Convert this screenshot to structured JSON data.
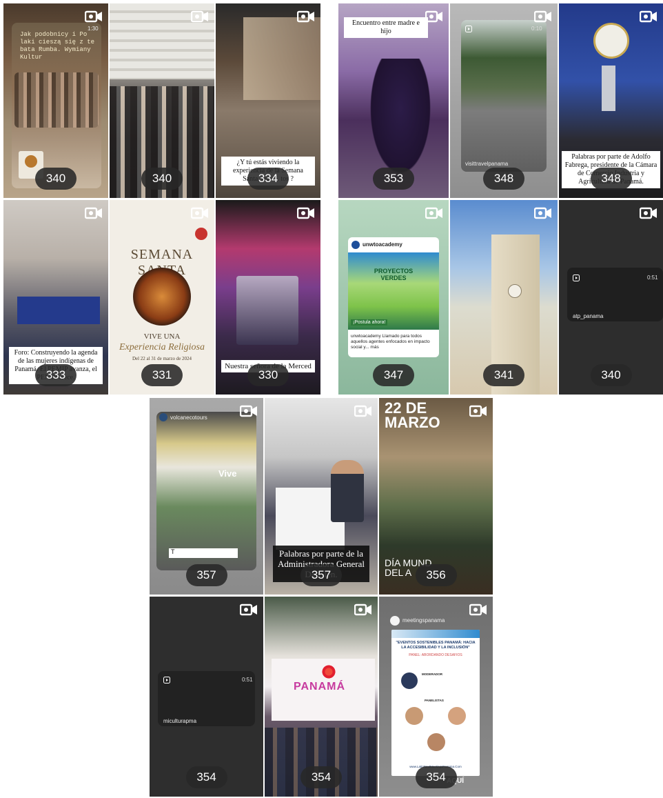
{
  "tiles": [
    {
      "count": "340",
      "overlay": "Jak podobnicy i Po laki cieszą się z te bata Rumba. Wymiany Kultur",
      "time": "1:30"
    },
    {
      "count": "340"
    },
    {
      "count": "334",
      "caption": "¿Y tú estás viviendo la experiencia de la Semana Santa, este ... tos ?"
    },
    {
      "count": "353",
      "caption": "Encuentro entre madre e hijo"
    },
    {
      "count": "348",
      "handle": "visittravelpanama",
      "time": "0:10"
    },
    {
      "count": "348",
      "caption": "Palabras por parte de Adolfo Fabrega, presidente de la Cámara de Comercio Industria y Agricultura de Panamá."
    },
    {
      "count": "333",
      "caption": "Foro: Construyendo la agenda de las mujeres indígenas de Panamá. El PEMIP avanza, el PEMIP crece."
    },
    {
      "count": "331",
      "title": "SEMANA SANTA",
      "subtitle": "VIVE UNA",
      "script": "Experiencia Religiosa",
      "dates": "Del 22 al 31 de marzo de 2024"
    },
    {
      "count": "330",
      "caption": "Nuestra señora de la Merced"
    },
    {
      "count": "347",
      "handle": "unwtoacademy",
      "card_title": "PROYECTOS VERDES",
      "card_cta": "¡Postula ahora!",
      "post_text": "unwtoacademy Llamado para todos aquellos agentes enfocados en impacto social y... más"
    },
    {
      "count": "341"
    },
    {
      "count": "340",
      "handle": "atp_panama",
      "time": "0:51"
    },
    {
      "count": "357",
      "handle": "volcanecotours",
      "vive": "Vive",
      "t": "T"
    },
    {
      "count": "357",
      "caption": "Palabras por parte de la Administradora General De... lén."
    },
    {
      "count": "356",
      "top": "22 DE MARZO",
      "bottom": "DÍA MUND DEL A"
    },
    {
      "count": "354",
      "handle": "miculturapma",
      "time": "0:51"
    },
    {
      "count": "354",
      "banner": "PANAMÁ"
    },
    {
      "count": "354",
      "handle": "meetingspanama",
      "heading": "\"EVENTOS SOSTENIBLES PANAMÁ: HACIA LA ACCESIBILIDAD Y LA INCLUSIÓN\"",
      "panel": "PANEL: ABORDANDO DESAFIOS",
      "moderator": "MODERADOR",
      "panelists": "PANELISTAS",
      "url": "www.LatinNextMeetingsPanama.Com",
      "cta": "AQUÍ"
    }
  ],
  "colors": {
    "count_bg": "#282828",
    "page_bg": "#ffffff"
  },
  "icons": {
    "camera": "video-camera-icon",
    "reel": "reel-icon"
  }
}
